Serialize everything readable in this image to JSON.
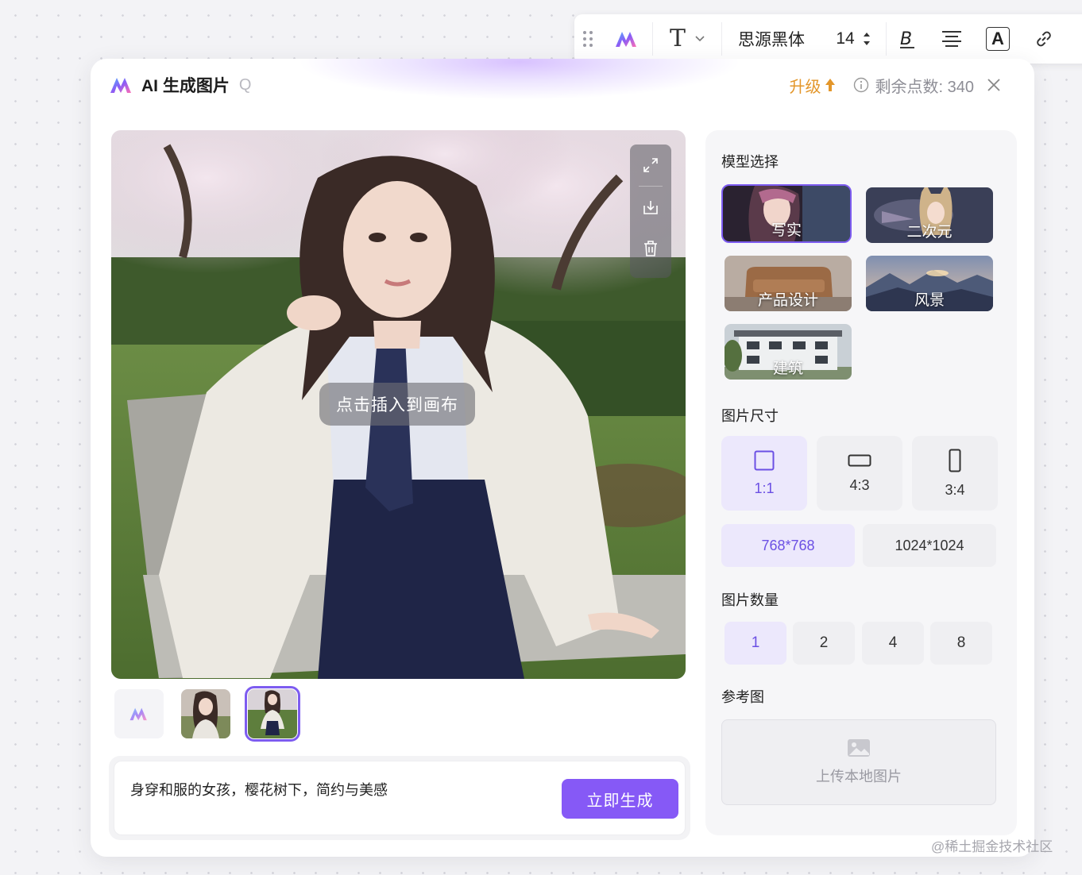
{
  "toolbar": {
    "font_name": "思源黑体",
    "font_size": "14",
    "text_icon_glyph": "T",
    "color_icon_glyph": "A"
  },
  "dialog": {
    "title": "AI 生成图片",
    "title_suffix": "Q",
    "upgrade_label": "升级",
    "points_label": "剩余点数: 340"
  },
  "preview": {
    "insert_label": "点击插入到画布"
  },
  "prompt": {
    "text": "身穿和服的女孩，樱花树下，简约与美感",
    "generate_label": "立即生成"
  },
  "panel": {
    "model_section": "模型选择",
    "models": [
      {
        "label": "写实",
        "selected": true
      },
      {
        "label": "二次元",
        "selected": false
      },
      {
        "label": "产品设计",
        "selected": false
      },
      {
        "label": "风景",
        "selected": false
      },
      {
        "label": "建筑",
        "selected": false
      }
    ],
    "size_section": "图片尺寸",
    "ratios": [
      {
        "label": "1:1",
        "selected": true
      },
      {
        "label": "4:3",
        "selected": false
      },
      {
        "label": "3:4",
        "selected": false
      }
    ],
    "resolutions": [
      {
        "label": "768*768",
        "selected": true
      },
      {
        "label": "1024*1024",
        "selected": false
      }
    ],
    "count_section": "图片数量",
    "counts": [
      {
        "label": "1",
        "selected": true
      },
      {
        "label": "2",
        "selected": false
      },
      {
        "label": "4",
        "selected": false
      },
      {
        "label": "8",
        "selected": false
      }
    ],
    "reference_section": "参考图",
    "upload_label": "上传本地图片"
  },
  "watermark": "@稀土掘金技术社区",
  "colors": {
    "accent": "#8659f6",
    "selected_bg": "#ece8fc",
    "upgrade": "#e3962a"
  }
}
